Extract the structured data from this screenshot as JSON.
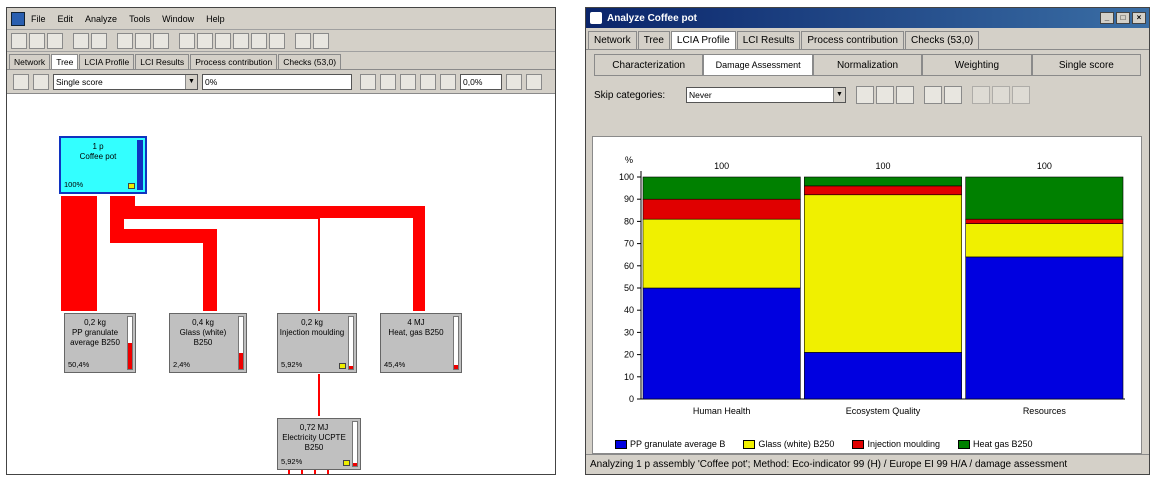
{
  "left": {
    "menu": [
      "File",
      "Edit",
      "Analyze",
      "Tools",
      "Window",
      "Help"
    ],
    "tabs": [
      "Network",
      "Tree",
      "LCIA Profile",
      "LCI Results",
      "Process contribution",
      "Checks (53,0)"
    ],
    "active_tab": 1,
    "indicator_select": "Single score",
    "cutoff_value": "0%",
    "cutoff_pct": "0,0%",
    "nodes": {
      "root": {
        "amount": "1 p",
        "name": "Coffee pot",
        "pct": "100%",
        "bar": 1.0
      },
      "pp": {
        "amount": "0,2 kg",
        "name": "PP granulate average B250",
        "pct": "50,4%",
        "bar": 0.5
      },
      "glass": {
        "amount": "0,4 kg",
        "name": "Glass (white) B250",
        "pct": "2,4%",
        "bar": 0.3
      },
      "injection": {
        "amount": "0,2 kg",
        "name": "Injection moulding",
        "pct": "5,92%",
        "bar": 0.06
      },
      "gas": {
        "amount": "4 MJ",
        "name": "Heat, gas B250",
        "pct": "45,4%",
        "bar": 0.08
      },
      "electricity": {
        "amount": "0,72 MJ",
        "name": "Electricity UCPTE B250",
        "pct": "5,92%",
        "bar": 0.06
      }
    }
  },
  "right": {
    "title": "Analyze Coffee pot",
    "tabs": [
      "Network",
      "Tree",
      "LCIA Profile",
      "LCI Results",
      "Process contribution",
      "Checks (53,0)"
    ],
    "active_tab": 2,
    "subtabs": [
      "Characterization",
      "Damage Assessment",
      "Normalization",
      "Weighting",
      "Single score"
    ],
    "active_subtab": 1,
    "skip_label": "Skip categories:",
    "skip_value": "Never",
    "status": "Analyzing 1 p assembly 'Coffee pot'; Method: Eco-indicator 99 (H) / Europe EI 99 H/A / damage assessment"
  },
  "chart_data": {
    "type": "bar",
    "stacked": true,
    "categories": [
      "Human Health",
      "Ecosystem Quality",
      "Resources"
    ],
    "ylabel": "%",
    "ylim": [
      0,
      100
    ],
    "yticks": [
      0,
      10,
      20,
      30,
      40,
      50,
      60,
      70,
      80,
      90,
      100
    ],
    "totals": [
      "100",
      "100",
      "100"
    ],
    "series": [
      {
        "name": "PP granulate average B",
        "color": "#0000e0",
        "values": [
          50,
          21,
          64
        ]
      },
      {
        "name": "Glass (white) B250",
        "color": "#f0f000",
        "values": [
          31,
          71,
          15
        ]
      },
      {
        "name": "Injection moulding",
        "color": "#e00000",
        "values": [
          9,
          4,
          2
        ]
      },
      {
        "name": "Heat gas B250",
        "color": "#008000",
        "values": [
          10,
          4,
          19
        ]
      }
    ],
    "legend": "bottom"
  }
}
